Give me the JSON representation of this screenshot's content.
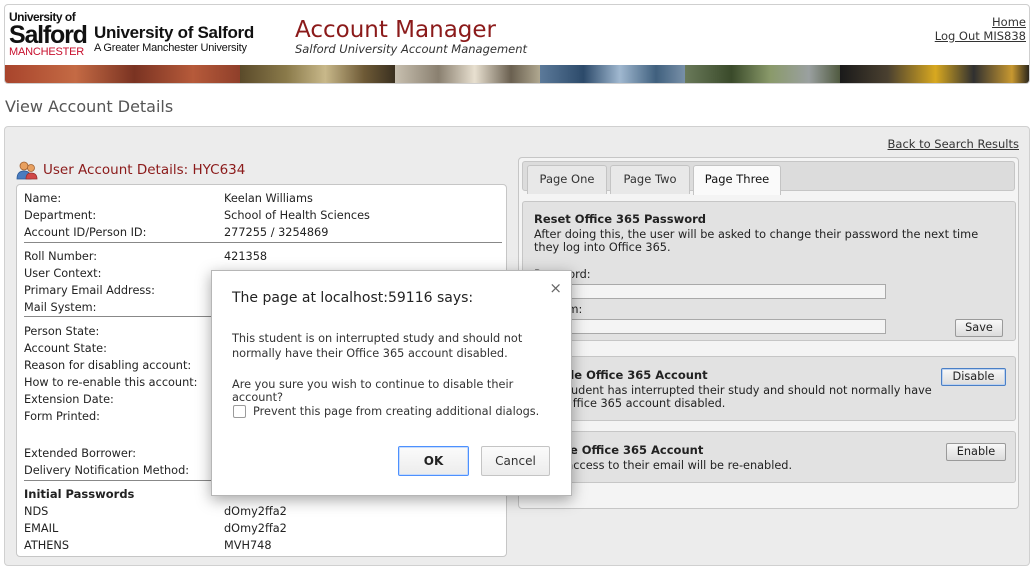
{
  "header": {
    "logo": {
      "line1": "University of",
      "line2": "Salford",
      "line3": "MANCHESTER"
    },
    "university_name": "University of Salford",
    "university_sub": "A Greater Manchester University",
    "app_title": "Account Manager",
    "app_subtitle": "Salford University Account Management",
    "links": {
      "home": "Home",
      "logout": "Log Out MIS838"
    }
  },
  "page": {
    "heading": "View Account Details",
    "back_link": "Back to Search Results"
  },
  "user_account": {
    "heading": "User Account Details: HYC634",
    "fields": [
      {
        "label": "Name:",
        "value": "Keelan Williams"
      },
      {
        "label": "Department:",
        "value": "School of Health Sciences"
      },
      {
        "label": "Account ID/Person ID:",
        "value": "277255 / 3254869"
      },
      {
        "label": "Roll Number:",
        "value": "421358"
      },
      {
        "label": "User Context:",
        "value": ""
      },
      {
        "label": "Primary Email Address:",
        "value": ""
      },
      {
        "label": "Mail System:",
        "value": ""
      },
      {
        "label": "Person State:",
        "value": ""
      },
      {
        "label": "Account State:",
        "value": ""
      },
      {
        "label": "Reason for disabling account:",
        "value": ""
      },
      {
        "label": "How to re-enable this account:",
        "value": ""
      },
      {
        "label": "Extension Date:",
        "value": ""
      },
      {
        "label": "Form Printed:",
        "value": ""
      },
      {
        "label": "Extended Borrower:",
        "value": ""
      },
      {
        "label": "Delivery Notification Method:",
        "value": ""
      }
    ],
    "passwords_heading": "Initial Passwords",
    "passwords": [
      {
        "label": "NDS",
        "value": "dOmy2ffa2"
      },
      {
        "label": "EMAIL",
        "value": "dOmy2ffa2"
      },
      {
        "label": "ATHENS",
        "value": "MVH748"
      }
    ]
  },
  "tabs": [
    {
      "label": "Page One",
      "active": false
    },
    {
      "label": "Page Two",
      "active": false
    },
    {
      "label": "Page Three",
      "active": true
    }
  ],
  "sections": {
    "reset": {
      "title": "Reset Office 365 Password",
      "desc": "After doing this, the user will be asked to change their password the next time they log into Office 365.",
      "password_label": "Password:",
      "confirm_label": "Confirm:",
      "save_label": "Save"
    },
    "disable": {
      "title": "Disable Office 365 Account",
      "desc": "This student has interrupted their study and should not normally have their Office 365 account disabled.",
      "button_label": "Disable"
    },
    "enable": {
      "title": "Enable Office 365 Account",
      "desc": "Their access to their email will be re-enabled.",
      "button_label": "Enable"
    }
  },
  "dialog": {
    "title": "The page at localhost:59116 says:",
    "close": "×",
    "message": "This student is on interrupted study and should not normally have their Office 365 account disabled.",
    "question": "Are you sure you wish to continue to disable their account?",
    "checkbox_label": "Prevent this page from creating additional dialogs.",
    "ok_label": "OK",
    "cancel_label": "Cancel"
  },
  "colors": {
    "brand_red": "#8b1a1a",
    "logo_red": "#c8102e",
    "dialog_focus": "#4d90fe"
  }
}
